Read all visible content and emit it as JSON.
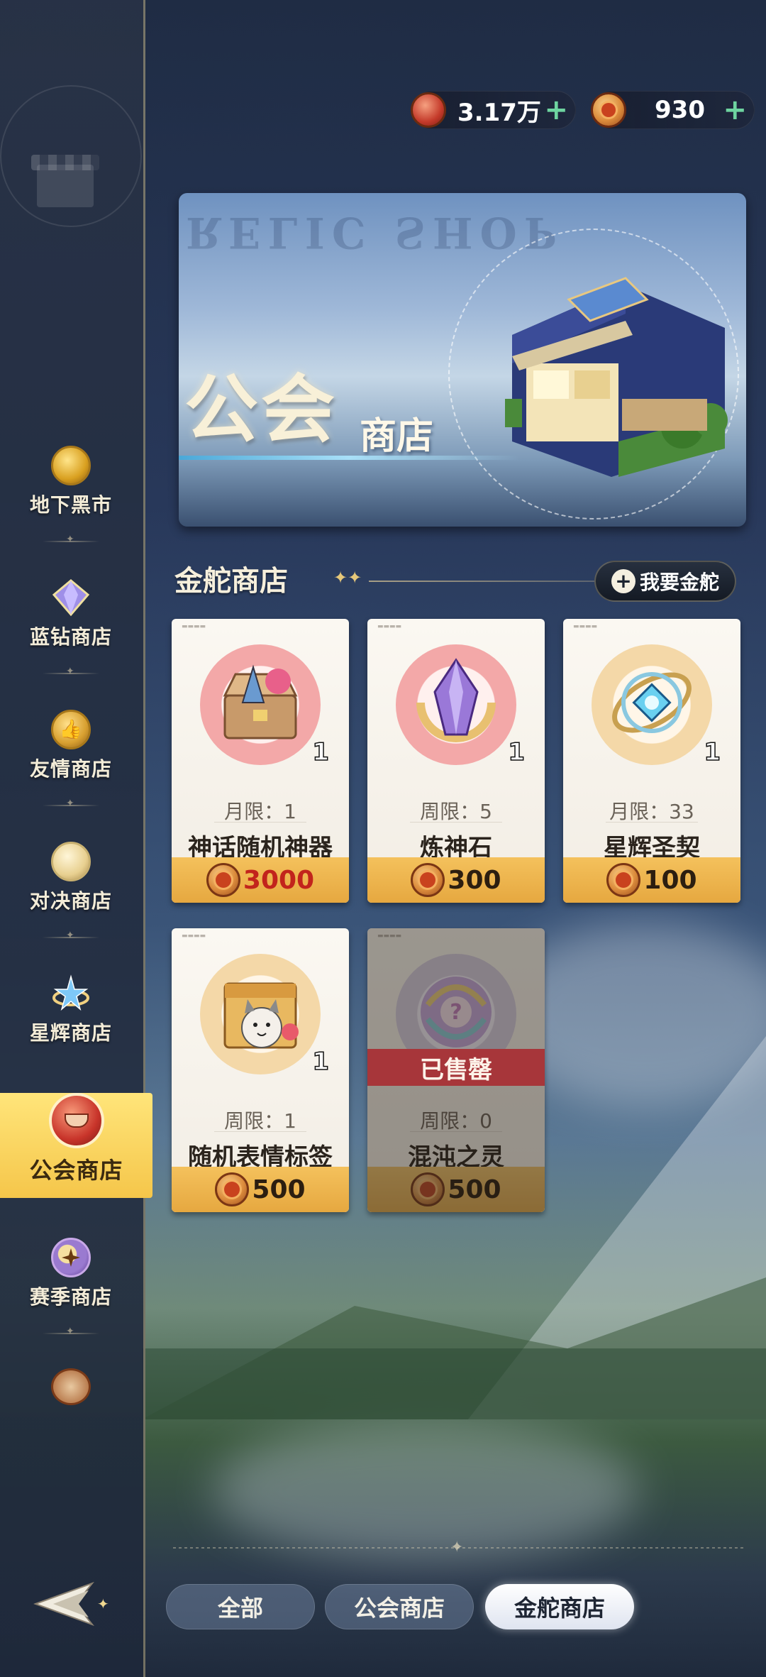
{
  "currencies": [
    {
      "name": "guild-coin",
      "value": "3.17万",
      "icon": "bowl-coin-icon"
    },
    {
      "name": "sun-coin",
      "value": "930",
      "icon": "sun-coin-icon"
    }
  ],
  "sidebar": {
    "items": [
      {
        "label": "地下黑市",
        "icon": "gold-coin-icon"
      },
      {
        "label": "蓝钻商店",
        "icon": "blue-diamond-icon"
      },
      {
        "label": "友情商店",
        "icon": "thumbs-up-coin-icon"
      },
      {
        "label": "对决商店",
        "icon": "duel-coin-icon"
      },
      {
        "label": "星辉商店",
        "icon": "star-coin-icon"
      },
      {
        "label": "公会商店",
        "icon": "guild-coin-icon"
      },
      {
        "label": "赛季商店",
        "icon": "season-coin-icon"
      }
    ],
    "active_index": 5
  },
  "banner": {
    "ghost_text": "RELIC SHOP",
    "title_big": "公会",
    "title_small": "商店"
  },
  "section": {
    "title": "金舵商店",
    "want_button": "我要金舵"
  },
  "cards": [
    {
      "limit": "月限：1",
      "name": "神话随机神器",
      "qty": "1",
      "price": "3000",
      "price_red": true,
      "sold": false,
      "art": "treasure-chest"
    },
    {
      "limit": "周限：5",
      "name": "炼神石",
      "qty": "1",
      "price": "300",
      "price_red": false,
      "sold": false,
      "art": "purple-crystal"
    },
    {
      "limit": "月限：33",
      "name": "星辉圣契",
      "qty": "1",
      "price": "100",
      "price_red": false,
      "sold": false,
      "art": "star-orb"
    },
    {
      "limit": "周限：1",
      "name": "随机表情标签",
      "qty": "1",
      "price": "500",
      "price_red": false,
      "sold": false,
      "art": "cat-box"
    },
    {
      "limit": "周限：0",
      "name": "混沌之灵",
      "qty": "",
      "price": "500",
      "price_red": false,
      "sold": true,
      "sold_label": "已售罄",
      "art": "chaos-orb"
    }
  ],
  "tabs": [
    {
      "label": "全部",
      "active": false
    },
    {
      "label": "公会商店",
      "active": false
    },
    {
      "label": "金舵商店",
      "active": true
    }
  ],
  "colors": {
    "accent_gold": "#f5c64a",
    "price_red": "#c2241c",
    "sold_red": "#b73236",
    "plus_green": "#6ed4a0"
  }
}
